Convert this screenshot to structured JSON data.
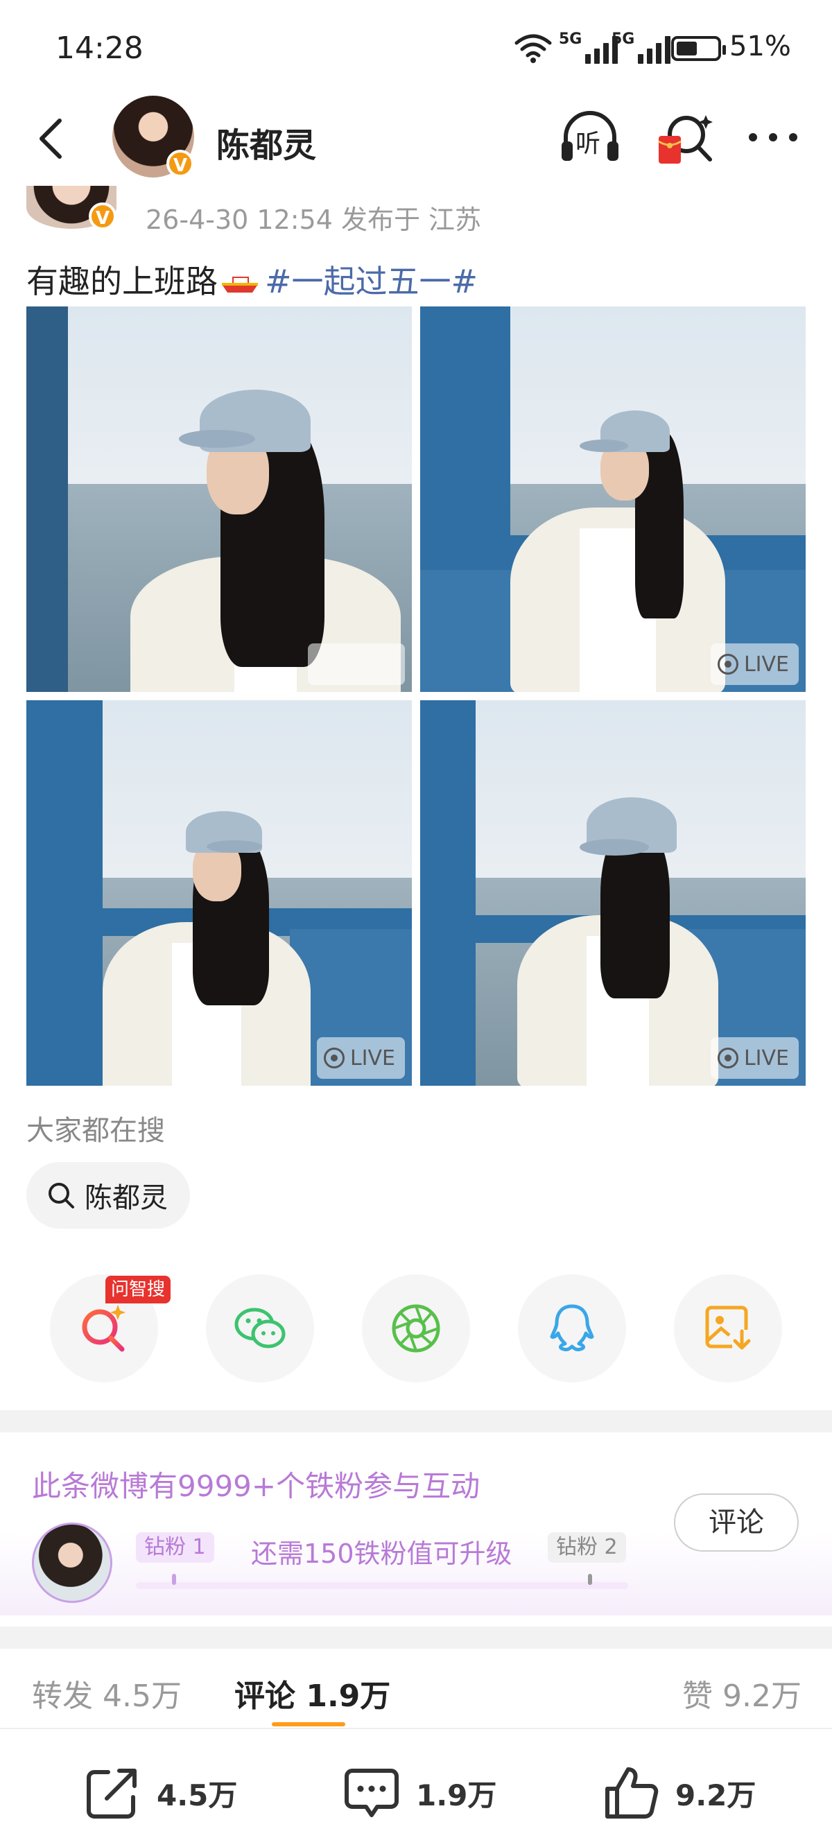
{
  "status_bar": {
    "time": "14:28",
    "net1": "5G",
    "net2": "5G",
    "battery": "51%",
    "battery_level": 0.51
  },
  "header": {
    "author": "陈都灵",
    "verified_badge": "V",
    "listen_label": "听"
  },
  "post": {
    "meta": "26-4-30 12:54  发布于 江苏",
    "text": "有趣的上班路",
    "hashtag": "#一起过五一#",
    "photos": [
      {
        "live": ""
      },
      {
        "live": "LIVE"
      },
      {
        "live": "LIVE"
      },
      {
        "live": "LIVE"
      }
    ]
  },
  "search": {
    "heading": "大家都在搜",
    "chip": "陈都灵"
  },
  "share": {
    "wenzhisou_badge": "问智搜",
    "icons": [
      "wenzhisou-icon",
      "wechat-icon",
      "moments-icon",
      "qq-icon",
      "save-image-icon"
    ]
  },
  "fans": {
    "title": "此条微博有9999+个铁粉参与互动",
    "level_current": "钻粉 1",
    "level_next": "钻粉 2",
    "need_text": "还需150铁粉值可升级",
    "comment_button": "评论"
  },
  "tabs": {
    "repost_label": "转发",
    "repost_count": "4.5万",
    "comment_label": "评论",
    "comment_count": "1.9万",
    "like_label": "赞",
    "like_count": "9.2万"
  },
  "actions": {
    "repost": "4.5万",
    "comment": "1.9万",
    "like": "9.2万"
  },
  "colors": {
    "hashtag": "#4b6aa8",
    "fans_purple": "#b87ad6",
    "tab_underline": "#ff9c1a",
    "badge_orange": "#f49a12",
    "red_badge": "#e8322e"
  }
}
